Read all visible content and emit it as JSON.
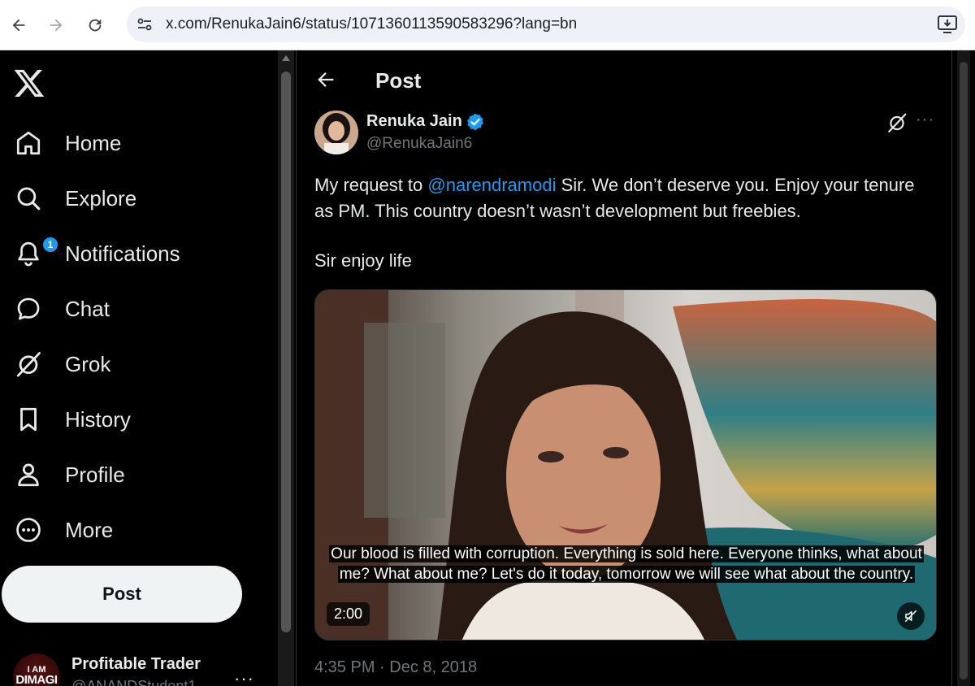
{
  "browser": {
    "url": "x.com/RenukaJain6/status/1071360113590583296?lang=bn",
    "back_icon": "arrow-left-icon",
    "forward_icon": "arrow-right-icon",
    "reload_icon": "reload-icon"
  },
  "sidebar": {
    "items": [
      {
        "label": "Home",
        "icon": "home-icon"
      },
      {
        "label": "Explore",
        "icon": "search-icon"
      },
      {
        "label": "Notifications",
        "icon": "bell-icon",
        "badge": "1"
      },
      {
        "label": "Chat",
        "icon": "chat-bubble-icon"
      },
      {
        "label": "Grok",
        "icon": "grok-icon"
      },
      {
        "label": "History",
        "icon": "bookmark-icon"
      },
      {
        "label": "Profile",
        "icon": "person-icon"
      },
      {
        "label": "More",
        "icon": "more-circle-icon"
      }
    ],
    "post_button": "Post",
    "account": {
      "name": "Profitable Trader",
      "handle": "@ANANDStudent1",
      "avatar_line1": "I AM",
      "avatar_line2": "DIMAGI",
      "more": "···"
    }
  },
  "post": {
    "header_title": "Post",
    "author_name": "Renuka Jain",
    "author_handle": "@RenukaJain6",
    "more": "···",
    "text_before": "My request to ",
    "mention": "@narendramodi",
    "text_after": " Sir. We don’t deserve you. Enjoy your tenure as PM. This country doesn’t wasn’t development but freebies.",
    "text_line2": "Sir enjoy life",
    "video": {
      "subtitle": "Our blood is filled with corruption. Everything is sold here. Everyone thinks, what about me? What about me? Let's do it today, tomorrow we will see what about the country.",
      "duration": "2:00"
    },
    "timestamp": "4:35 PM · Dec 8, 2018"
  },
  "colors": {
    "accent": "#1d9bf0",
    "text": "#e7e9ea",
    "muted": "#71767b",
    "background": "#000000"
  }
}
